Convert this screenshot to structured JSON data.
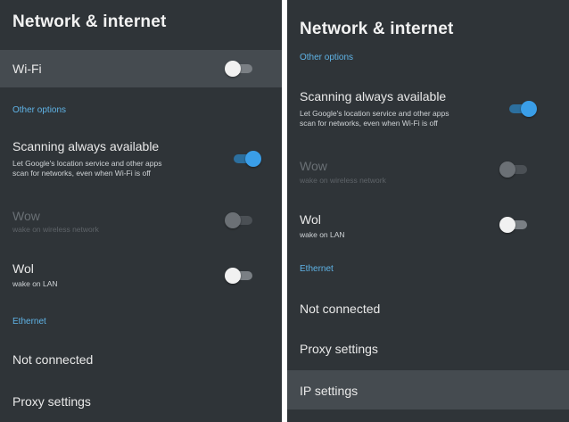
{
  "left": {
    "title": "Network & internet",
    "wifi_label": "Wi-Fi",
    "other_options": "Other options",
    "scanning_title": "Scanning always available",
    "scanning_desc_1": "Let Google's location service and other apps",
    "scanning_desc_2": "scan for networks, even when Wi-Fi is off",
    "wow_title": "Wow",
    "wow_desc": "wake on wireless network",
    "wol_title": "Wol",
    "wol_desc": "wake on LAN",
    "ethernet": "Ethernet",
    "not_connected": "Not connected",
    "proxy": "Proxy settings"
  },
  "right": {
    "title": "Network & internet",
    "other_options": "Other options",
    "scanning_title": "Scanning always available",
    "scanning_desc_1": "Let Google's location service and other apps",
    "scanning_desc_2": "scan for networks, even when Wi-Fi is off",
    "wow_title": "Wow",
    "wow_desc": "wake on wireless network",
    "wol_title": "Wol",
    "wol_desc": "wake on LAN",
    "ethernet": "Ethernet",
    "not_connected": "Not connected",
    "proxy": "Proxy settings",
    "ip": "IP settings"
  },
  "toggles": {
    "wifi": "off",
    "scanning": "on",
    "wow": "disabled-off",
    "wol": "off"
  },
  "colors": {
    "background": "#2f3438",
    "highlight": "#454b50",
    "accent": "#3a9ee8",
    "section_header": "#5fb3e6"
  }
}
